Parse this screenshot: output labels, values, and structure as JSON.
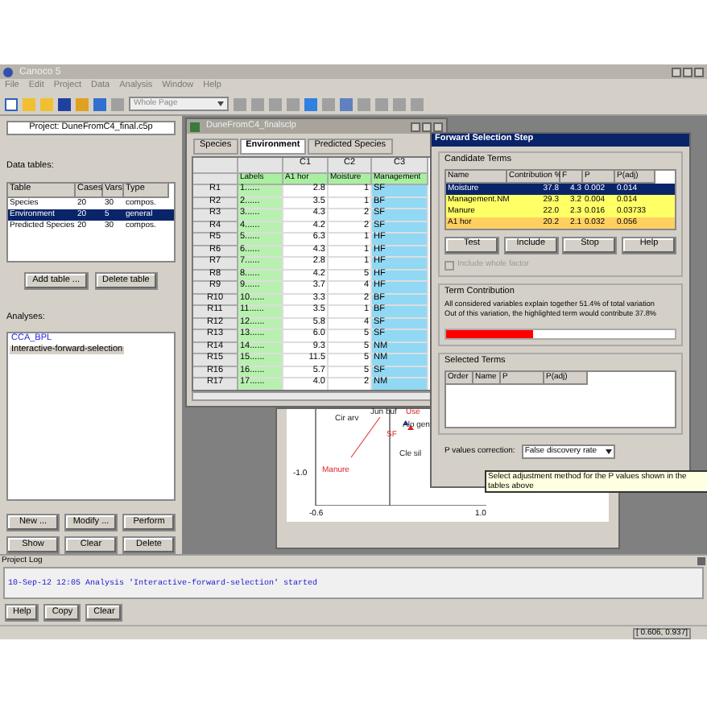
{
  "app": {
    "title": "Canoco 5",
    "menu": [
      "File",
      "Edit",
      "Project",
      "Data",
      "Analysis",
      "Window",
      "Help"
    ],
    "page_select": "Whole Page"
  },
  "project": {
    "value": "Project: DuneFromC4_final.c5p"
  },
  "data_tables": {
    "label": "Data tables:",
    "columns": [
      "Table",
      "Cases",
      "Vars",
      "Type"
    ],
    "rows": [
      {
        "cells": [
          "Species",
          "20",
          "30",
          "compos."
        ],
        "selected": false
      },
      {
        "cells": [
          "Environment",
          "20",
          "5",
          "general"
        ],
        "selected": true
      },
      {
        "cells": [
          "Predicted Species",
          "20",
          "30",
          "compos."
        ],
        "selected": false
      }
    ],
    "buttons": [
      "Add table ...",
      "Delete table"
    ]
  },
  "analyses": {
    "label": "Analyses:",
    "items": [
      {
        "text": "CCA_BPL",
        "selected": false
      },
      {
        "text": "Interactive-forward-selection",
        "selected": true
      }
    ],
    "buttons": [
      "New ...",
      "Modify ...",
      "Perform",
      "Show",
      "Clear",
      "Delete"
    ]
  },
  "data_window": {
    "title": "DuneFromC4_finalsclp",
    "tabs": [
      {
        "label": "Species",
        "selected": false
      },
      {
        "label": "Environment",
        "selected": true
      },
      {
        "label": "Predicted Species",
        "selected": false
      }
    ],
    "column_ids": [
      "C1",
      "C2",
      "C3"
    ],
    "headers": [
      "Labels",
      "A1 hor",
      "Moisture",
      "Management"
    ],
    "rows": [
      {
        "id": "R1",
        "label": "1......",
        "values": [
          "2.8",
          "1",
          "SF"
        ]
      },
      {
        "id": "R2",
        "label": "2......",
        "values": [
          "3.5",
          "1",
          "BF"
        ]
      },
      {
        "id": "R3",
        "label": "3......",
        "values": [
          "4.3",
          "2",
          "SF"
        ]
      },
      {
        "id": "R4",
        "label": "4......",
        "values": [
          "4.2",
          "2",
          "SF"
        ]
      },
      {
        "id": "R5",
        "label": "5......",
        "values": [
          "6.3",
          "1",
          "HF"
        ]
      },
      {
        "id": "R6",
        "label": "6......",
        "values": [
          "4.3",
          "1",
          "HF"
        ]
      },
      {
        "id": "R7",
        "label": "7......",
        "values": [
          "2.8",
          "1",
          "HF"
        ]
      },
      {
        "id": "R8",
        "label": "8......",
        "values": [
          "4.2",
          "5",
          "HF"
        ]
      },
      {
        "id": "R9",
        "label": "9......",
        "values": [
          "3.7",
          "4",
          "HF"
        ]
      },
      {
        "id": "R10",
        "label": "10......",
        "values": [
          "3.3",
          "2",
          "BF"
        ]
      },
      {
        "id": "R11",
        "label": "11......",
        "values": [
          "3.5",
          "1",
          "BF"
        ]
      },
      {
        "id": "R12",
        "label": "12......",
        "values": [
          "5.8",
          "4",
          "SF"
        ]
      },
      {
        "id": "R13",
        "label": "13......",
        "values": [
          "6.0",
          "5",
          "SF"
        ]
      },
      {
        "id": "R14",
        "label": "14......",
        "values": [
          "9.3",
          "5",
          "NM"
        ]
      },
      {
        "id": "R15",
        "label": "15......",
        "values": [
          "11.5",
          "5",
          "NM"
        ]
      },
      {
        "id": "R16",
        "label": "16......",
        "values": [
          "5.7",
          "5",
          "SF"
        ]
      },
      {
        "id": "R17",
        "label": "17......",
        "values": [
          "4.0",
          "2",
          "NM"
        ]
      }
    ]
  },
  "graph": {
    "labels": [
      {
        "text": "Cir arv",
        "kind": "species"
      },
      {
        "text": "Jun buf",
        "kind": "species"
      },
      {
        "text": "Use",
        "kind": "variable"
      },
      {
        "text": "SF",
        "kind": "variable"
      },
      {
        "text": "Alo gen",
        "kind": "species"
      },
      {
        "text": "Manure",
        "kind": "variable"
      },
      {
        "text": "Cle sil",
        "kind": "species"
      }
    ],
    "ticks": [
      "-0.6",
      "1.0",
      "-1.0"
    ]
  },
  "dialog": {
    "title": "Forward Selection Step",
    "candidate": {
      "label": "Candidate Terms",
      "columns": [
        "Name",
        "Contribution %",
        "F",
        "P",
        "P(adj)"
      ],
      "rows": [
        {
          "cells": [
            "Moisture",
            "37.8",
            "4.3",
            "0.002",
            "0.014"
          ],
          "selected": true
        },
        {
          "cells": [
            "Management.NM",
            "29.3",
            "3.2",
            "0.004",
            "0.014"
          ],
          "selected": false,
          "color": "#ffff66"
        },
        {
          "cells": [
            "Manure",
            "22.0",
            "2.3",
            "0.016",
            "0.03733"
          ],
          "selected": false,
          "color": "#ffff66"
        },
        {
          "cells": [
            "A1 hor",
            "20.2",
            "2.1",
            "0.032",
            "0.056"
          ],
          "selected": false,
          "color": "#ffd060"
        }
      ]
    },
    "buttons": [
      "Test",
      "Include",
      "Stop",
      "Help"
    ],
    "whole_factor": {
      "label": "Include whole factor",
      "checked": false,
      "disabled": true
    },
    "term_contribution": {
      "label": "Term Contribution",
      "lines": [
        "All considered variables explain together 51.4% of total variation",
        "Out of this variation, the highlighted term would contribute 37.8%"
      ],
      "level": 0.378
    },
    "selected_terms": {
      "label": "Selected Terms",
      "columns": [
        "Order",
        "Name",
        "P",
        "P(adj)"
      ]
    },
    "p_correction": {
      "label": "P values correction:",
      "value": "False discovery rate"
    }
  },
  "tooltip": {
    "lines": [
      "Select adjustment method for the P values shown in the",
      "tables above"
    ]
  },
  "log": {
    "title": "Project Log",
    "lines": [
      "10-Sep-12 12:05 Analysis 'Interactive-forward-selection' started"
    ],
    "buttons": [
      "Help",
      "Copy",
      "Clear"
    ]
  },
  "status": "[ 0.606, 0.937]"
}
